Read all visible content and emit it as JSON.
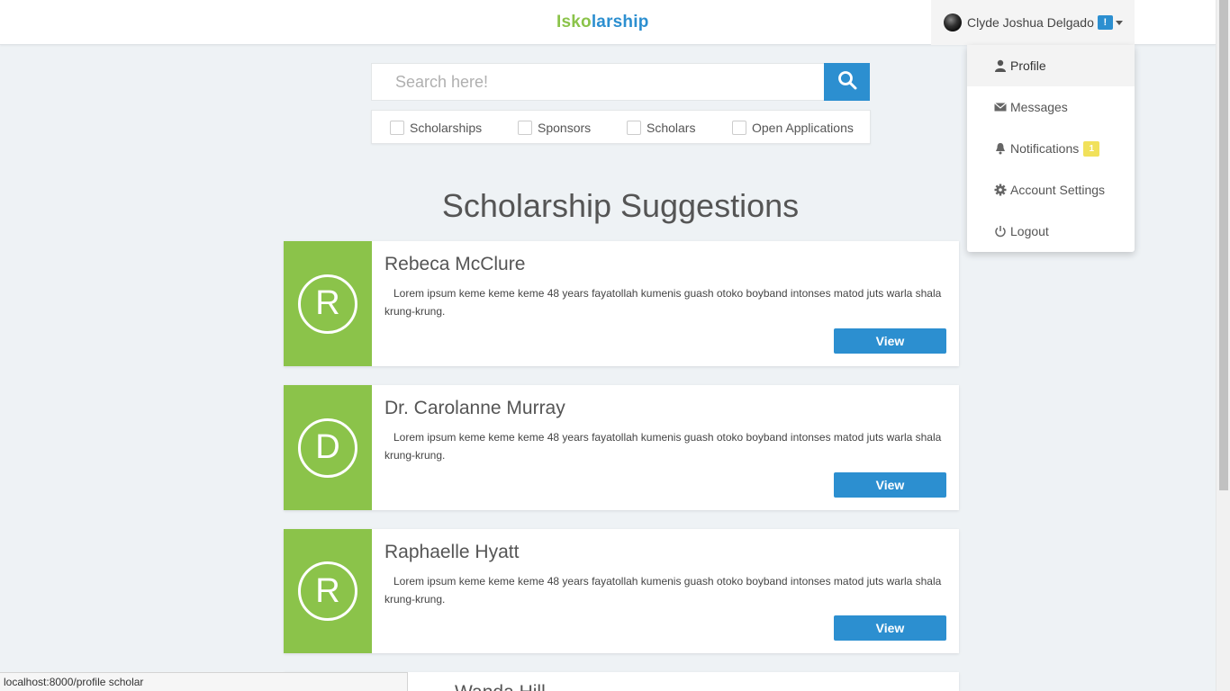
{
  "navbar": {
    "brand_part1": "Isko",
    "brand_part2": "larship",
    "user_name": "Clyde Joshua Delgado",
    "user_badge": "!"
  },
  "dropdown": {
    "items": [
      {
        "label": "Profile",
        "icon": "person-icon"
      },
      {
        "label": "Messages",
        "icon": "envelope-icon"
      },
      {
        "label": "Notifications",
        "icon": "bell-icon",
        "badge": "1"
      },
      {
        "label": "Account Settings",
        "icon": "gear-icon"
      },
      {
        "label": "Logout",
        "icon": "power-icon"
      }
    ]
  },
  "search": {
    "placeholder": "Search here!"
  },
  "filters": [
    "Scholarships",
    "Sponsors",
    "Scholars",
    "Open Applications"
  ],
  "page_title": "Scholarship Suggestions",
  "cards": [
    {
      "initial": "R",
      "name": "Rebeca McClure",
      "description": "Lorem ipsum keme keme keme 48 years fayatollah kumenis guash otoko boyband intonses matod juts warla shala krung-krung.",
      "button": "View"
    },
    {
      "initial": "D",
      "name": "Dr. Carolanne Murray",
      "description": "Lorem ipsum keme keme keme 48 years fayatollah kumenis guash otoko boyband intonses matod juts warla shala krung-krung.",
      "button": "View"
    },
    {
      "initial": "R",
      "name": "Raphaelle Hyatt",
      "description": "Lorem ipsum keme keme keme 48 years fayatollah kumenis guash otoko boyband intonses matod juts warla shala krung-krung.",
      "button": "View"
    }
  ],
  "card4_partial_name": "Wanda Hill",
  "status_url": "localhost:8000/profile scholar",
  "colors": {
    "accent": "#2c8fd0",
    "brand_green": "#8bc34a",
    "badge_yellow": "#f1e15b"
  }
}
